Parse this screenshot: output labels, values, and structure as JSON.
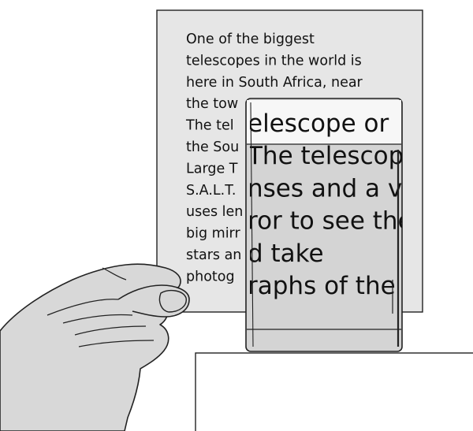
{
  "paper": {
    "lines": [
      "One of the biggest",
      "telescopes in the world is",
      "here in South Africa, near",
      "the tow",
      "The tel",
      "the Sou",
      "Large T",
      "S.A.L.T.",
      "uses len",
      "big mirr",
      "stars an",
      "photog"
    ]
  },
  "glass": {
    "lines": [
      "elescope or",
      "The telescop",
      "nses and a ve",
      "ror to see the",
      "d take",
      "raphs of the"
    ]
  },
  "colors": {
    "paper_fill": "#e6e6e6",
    "glass_fill": "#d4d4d4",
    "glass_top_fill": "#f7f7f7",
    "hand_fill": "#d8d8d8",
    "box_fill": "#ffffff",
    "outline": "#222222"
  },
  "icons": {
    "hand": "hand-holding-paper-icon",
    "magnifier": "handheld-magnifier-icon"
  }
}
